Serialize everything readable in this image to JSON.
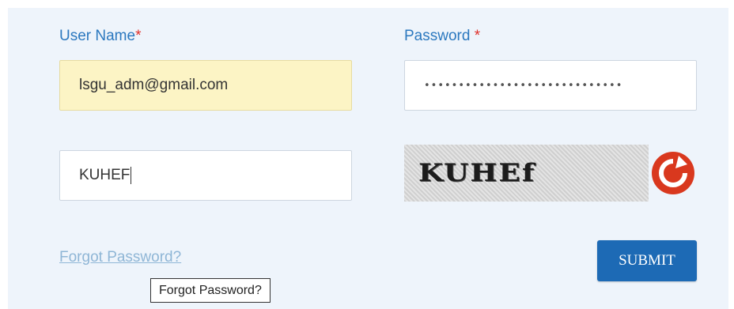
{
  "username": {
    "label": "User Name",
    "required_mark": "*",
    "value": "lsgu_adm@gmail.com"
  },
  "password": {
    "label": "Password ",
    "required_mark": "*",
    "masked_value": "•••••••••••••••••••••••••••••"
  },
  "captcha": {
    "input_value": "KUHEF",
    "image_text": "KUHEf",
    "refresh_icon": "refresh-icon"
  },
  "links": {
    "forgot_password": "Forgot Password?"
  },
  "tooltip": {
    "text": "Forgot Password?"
  },
  "actions": {
    "submit_label": "SUBMIT"
  },
  "colors": {
    "label": "#2b78bf",
    "required": "#e0302a",
    "autofill_bg": "#fcf4c5",
    "submit_bg": "#1d6ab5",
    "refresh": "#d9381e"
  }
}
